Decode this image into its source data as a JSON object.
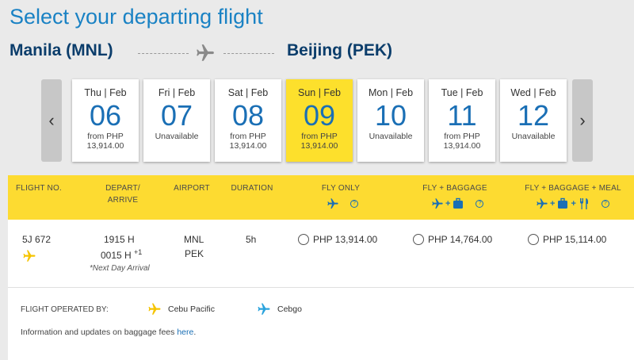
{
  "title": "Select your departing flight",
  "route": {
    "origin": "Manila (MNL)",
    "destination": "Beijing (PEK)"
  },
  "dates": [
    {
      "day": "Thu | Feb",
      "num": "06",
      "from": "from PHP",
      "price": "13,914.00",
      "status": ""
    },
    {
      "day": "Fri | Feb",
      "num": "07",
      "from": "",
      "price": "",
      "status": "Unavailable"
    },
    {
      "day": "Sat | Feb",
      "num": "08",
      "from": "from PHP",
      "price": "13,914.00",
      "status": ""
    },
    {
      "day": "Sun | Feb",
      "num": "09",
      "from": "from PHP",
      "price": "13,914.00",
      "status": "",
      "selected": true
    },
    {
      "day": "Mon | Feb",
      "num": "10",
      "from": "",
      "price": "",
      "status": "Unavailable"
    },
    {
      "day": "Tue | Feb",
      "num": "11",
      "from": "from PHP",
      "price": "13,914.00",
      "status": ""
    },
    {
      "day": "Wed | Feb",
      "num": "12",
      "from": "",
      "price": "",
      "status": "Unavailable"
    }
  ],
  "nav": {
    "prev": "‹",
    "next": "›"
  },
  "table": {
    "headers": {
      "flight_no": "FLIGHT NO.",
      "depart_arrive_1": "DEPART/",
      "depart_arrive_2": "ARRIVE",
      "airport": "AIRPORT",
      "duration": "DURATION",
      "fly_only": "FLY ONLY",
      "fly_baggage": "FLY + BAGGAGE",
      "fly_baggage_meal": "FLY + BAGGAGE + MEAL"
    },
    "row": {
      "flight_no": "5J 672",
      "depart": "1915 H",
      "arrive": "0015 H",
      "arrive_sup": "+1",
      "next_day": "*Next Day Arrival",
      "origin_airport": "MNL",
      "dest_airport": "PEK",
      "duration": "5h",
      "fare_fly_only": "PHP 13,914.00",
      "fare_fly_baggage": "PHP 14,764.00",
      "fare_fly_baggage_meal": "PHP 15,114.00"
    }
  },
  "footer": {
    "operated_by": "FLIGHT OPERATED BY:",
    "carrier_1": "Cebu Pacific",
    "carrier_2": "Cebgo",
    "info_text": "Information and updates on baggage fees ",
    "info_link": "here",
    "info_end": "."
  },
  "colors": {
    "accent_blue": "#1a6fb5",
    "yellow": "#fddb31",
    "cebgo_blue": "#2aa3dd",
    "cebu_yellow": "#f5c400"
  }
}
